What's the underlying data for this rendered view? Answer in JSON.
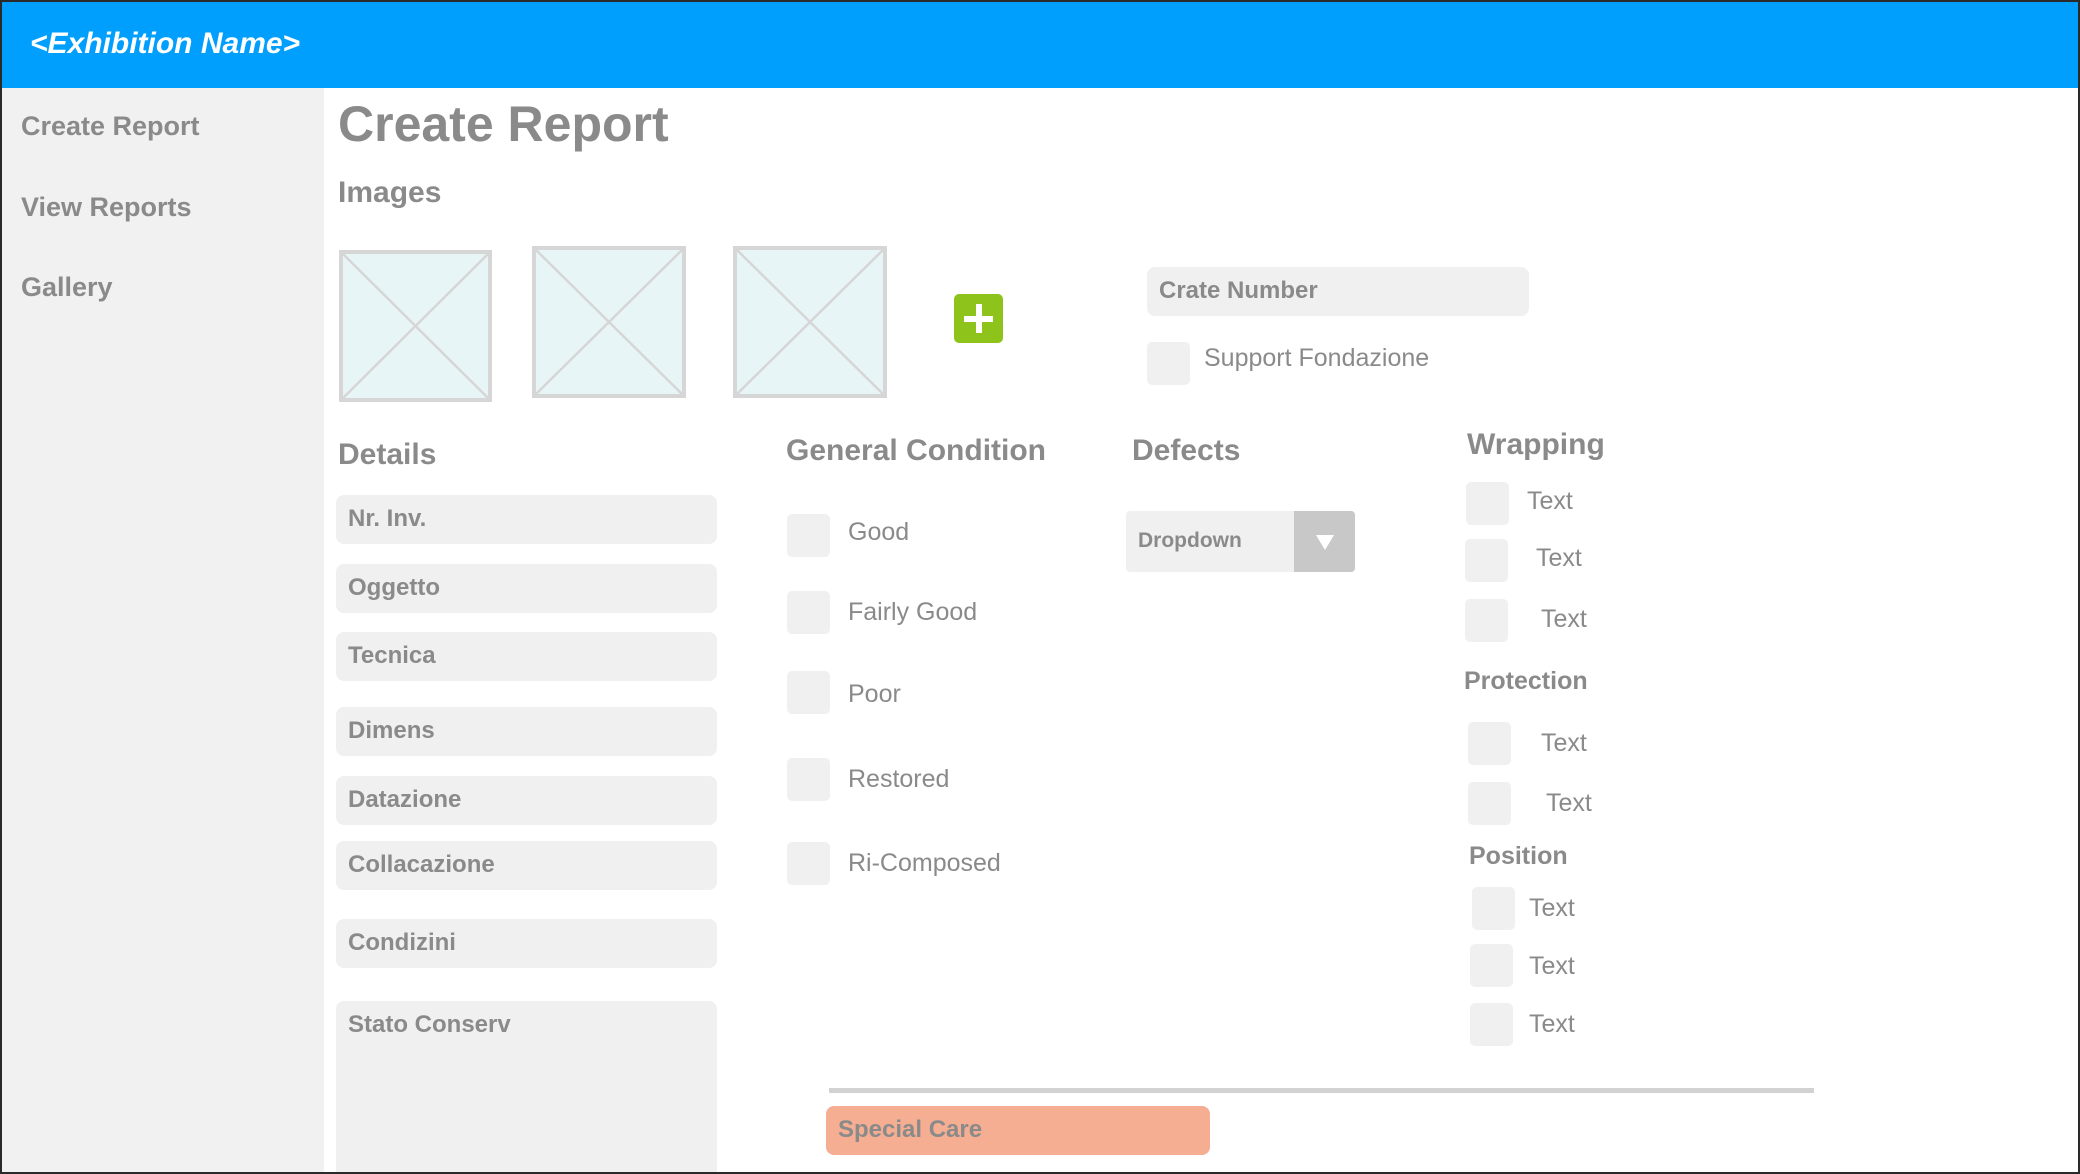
{
  "header": {
    "title": "<Exhibition Name>"
  },
  "sidebar": {
    "items": [
      {
        "label": "Create Report"
      },
      {
        "label": "View Reports"
      },
      {
        "label": "Gallery"
      }
    ]
  },
  "main": {
    "title": "Create Report",
    "images": {
      "title": "Images"
    },
    "crate_number": {
      "label": "Crate Number"
    },
    "support_fondazione": {
      "label": "Support Fondazione"
    },
    "details": {
      "title": "Details",
      "fields": [
        {
          "label": "Nr. Inv."
        },
        {
          "label": "Oggetto"
        },
        {
          "label": "Tecnica"
        },
        {
          "label": "Dimens"
        },
        {
          "label": "Datazione"
        },
        {
          "label": "Collacazione"
        },
        {
          "label": "Condizini"
        },
        {
          "label": "Stato Conserv"
        }
      ]
    },
    "general_condition": {
      "title": "General Condition",
      "options": [
        {
          "label": "Good"
        },
        {
          "label": "Fairly Good"
        },
        {
          "label": "Poor"
        },
        {
          "label": "Restored"
        },
        {
          "label": "Ri-Composed"
        }
      ]
    },
    "defects": {
      "title": "Defects",
      "dropdown": {
        "value": "Dropdown"
      }
    },
    "wrapping": {
      "title": "Wrapping",
      "options": [
        {
          "label": "Text"
        },
        {
          "label": "Text"
        },
        {
          "label": "Text"
        }
      ]
    },
    "protection": {
      "title": "Protection",
      "options": [
        {
          "label": "Text"
        },
        {
          "label": "Text"
        }
      ]
    },
    "position": {
      "title": "Position",
      "options": [
        {
          "label": "Text"
        },
        {
          "label": "Text"
        },
        {
          "label": "Text"
        }
      ]
    },
    "special_care": {
      "label": "Special Care"
    }
  },
  "colors": {
    "header": "#009ffe",
    "add_button": "#8ec31b",
    "special_care": "#f5ae92",
    "field": "#f0f0f0",
    "text": "#8a8a8a"
  }
}
